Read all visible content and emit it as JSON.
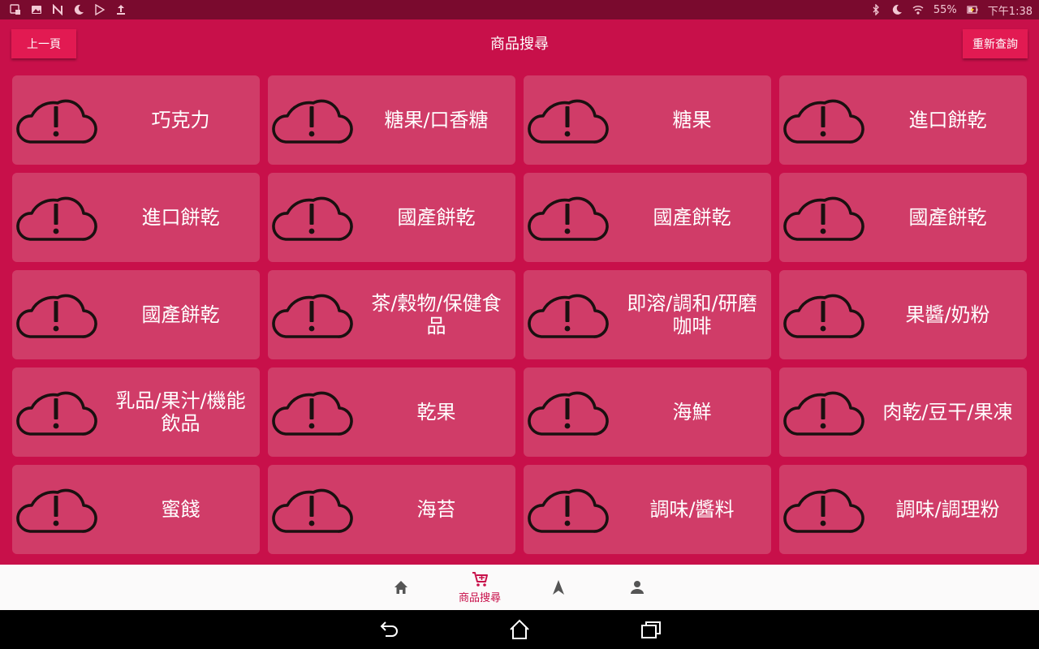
{
  "status_bar": {
    "left_icons": [
      "image-upload-icon",
      "gallery-icon",
      "n-icon",
      "moon-icon",
      "play-store-icon",
      "upload-icon"
    ],
    "right_icons": [
      "bluetooth-icon",
      "moon-icon",
      "wifi-icon",
      "battery-charging-icon"
    ],
    "battery": "55%",
    "time": "下午1:38"
  },
  "header": {
    "back_label": "上一頁",
    "title": "商品搜尋",
    "reset_label": "重新查詢"
  },
  "categories": [
    {
      "label": "巧克力",
      "icon": "cloud-alert-icon"
    },
    {
      "label": "糖果/口香糖",
      "icon": "cloud-alert-icon"
    },
    {
      "label": "糖果",
      "icon": "cloud-alert-icon"
    },
    {
      "label": "進口餅乾",
      "icon": "cloud-alert-icon"
    },
    {
      "label": "進口餅乾",
      "icon": "cloud-alert-icon"
    },
    {
      "label": "國產餅乾",
      "icon": "cloud-alert-icon"
    },
    {
      "label": "國產餅乾",
      "icon": "cloud-alert-icon"
    },
    {
      "label": "國產餅乾",
      "icon": "cloud-alert-icon"
    },
    {
      "label": "國產餅乾",
      "icon": "cloud-alert-icon"
    },
    {
      "label": "茶/穀物/保健食品",
      "icon": "cloud-alert-icon"
    },
    {
      "label": "即溶/調和/研磨咖啡",
      "icon": "cloud-alert-icon"
    },
    {
      "label": "果醬/奶粉",
      "icon": "cloud-alert-icon"
    },
    {
      "label": "乳品/果汁/機能飲品",
      "icon": "cloud-alert-icon"
    },
    {
      "label": "乾果",
      "icon": "cloud-alert-icon"
    },
    {
      "label": "海鮮",
      "icon": "cloud-alert-icon"
    },
    {
      "label": "肉乾/豆干/果凍",
      "icon": "cloud-alert-icon"
    },
    {
      "label": "蜜餞",
      "icon": "cloud-alert-icon"
    },
    {
      "label": "海苔",
      "icon": "cloud-alert-icon"
    },
    {
      "label": "調味/醬料",
      "icon": "cloud-alert-icon"
    },
    {
      "label": "調味/調理粉",
      "icon": "cloud-alert-icon"
    }
  ],
  "bottom_nav": {
    "items": [
      {
        "icon": "home-icon",
        "label": ""
      },
      {
        "icon": "cart-icon",
        "label": "商品搜尋",
        "active": true
      },
      {
        "icon": "navigation-arrow-icon",
        "label": ""
      },
      {
        "icon": "person-icon",
        "label": ""
      }
    ]
  },
  "system_nav": {
    "buttons": [
      "back-icon",
      "home-icon",
      "recents-icon"
    ]
  },
  "colors": {
    "primary": "#c8104a",
    "status_bar": "#7a0a2e",
    "tile": "#d03c68",
    "button": "#e21a52",
    "nav_bg": "#fbfafa"
  }
}
